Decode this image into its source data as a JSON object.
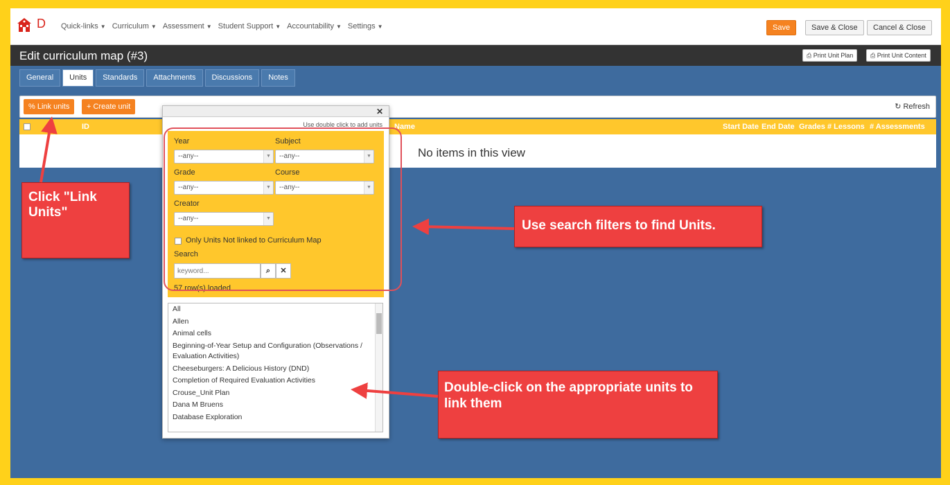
{
  "nav": {
    "logo_letter": "D",
    "menu": [
      "Quick-links",
      "Curriculum",
      "Assessment",
      "Student Support",
      "Accountability",
      "Settings"
    ],
    "save": "Save",
    "save_close": "Save & Close",
    "cancel_close": "Cancel & Close"
  },
  "header": {
    "title": "Edit curriculum map (#3)",
    "print_plan": "Print Unit Plan",
    "print_content": "Print Unit Content"
  },
  "tabs": [
    "General",
    "Units",
    "Standards",
    "Attachments",
    "Discussions",
    "Notes"
  ],
  "active_tab": "Units",
  "toolbar": {
    "link_units": "Link units",
    "create_unit": "Create unit",
    "refresh": "Refresh"
  },
  "grid": {
    "columns": [
      "ID",
      "Name",
      "Start Date",
      "End Date",
      "Grades",
      "# Lessons",
      "# Assessments"
    ],
    "empty": "No items in this view"
  },
  "popup": {
    "hint": "Use double click to add units",
    "year_label": "Year",
    "subject_label": "Subject",
    "grade_label": "Grade",
    "course_label": "Course",
    "creator_label": "Creator",
    "any": "--any--",
    "only_unlinked": "Only Units Not linked to Curriculum Map",
    "search_label": "Search",
    "search_placeholder": "keyword...",
    "rows_loaded": "57 row(s) loaded",
    "units": [
      "All",
      "Allen",
      "Animal cells",
      "Beginning-of-Year Setup and Configuration (Observations / Evaluation Activities)",
      "Cheeseburgers: A Delicious History (DND)",
      "Completion of Required Evaluation Activities",
      "Crouse_Unit Plan",
      "Dana M Bruens",
      "Database Exploration"
    ]
  },
  "annotations": {
    "click_link": "Click \"Link Units\"",
    "use_filters": "Use search filters to find Units.",
    "double_click": "Double-click on the appropriate units to link them"
  },
  "colors": {
    "border": "#ffd11a",
    "background": "#3e6b9e",
    "accent": "#f58220",
    "filter_panel": "#ffc72c",
    "callout": "#ee4040"
  }
}
